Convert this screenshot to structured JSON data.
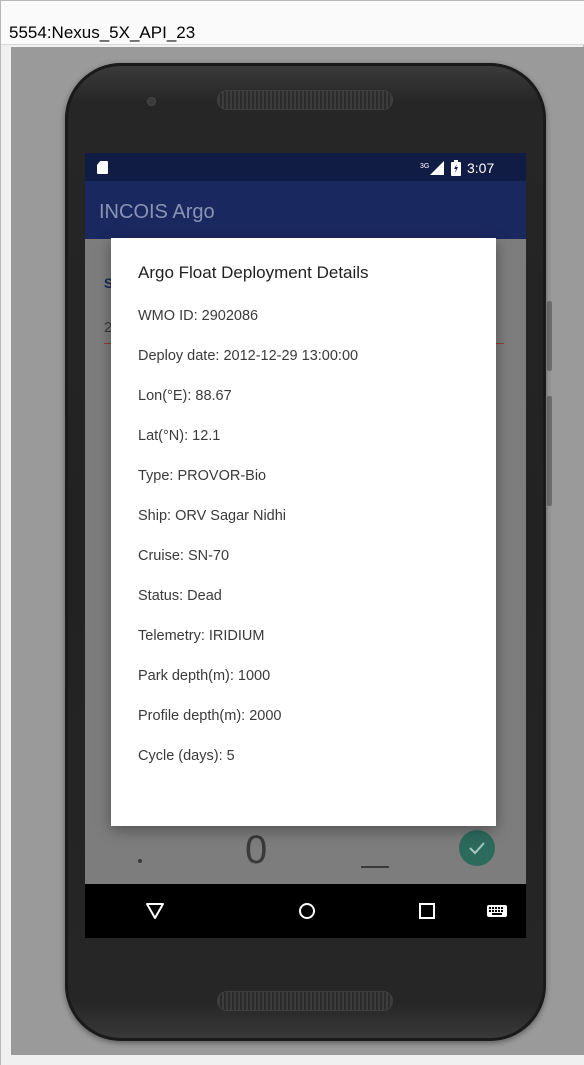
{
  "window": {
    "title": "5554:Nexus_5X_API_23"
  },
  "status_bar": {
    "network_label": "3G",
    "time": "3:07"
  },
  "app_bar": {
    "title": "INCOIS Argo"
  },
  "background": {
    "label_fragment": "S",
    "input_fragment": "2",
    "keypad": {
      "dot_key": ".",
      "zero_key": "0"
    }
  },
  "dialog": {
    "title": "Argo Float Deployment Details",
    "rows": [
      "WMO ID: 2902086",
      "Deploy date: 2012-12-29 13:00:00",
      "Lon(°E): 88.67",
      "Lat(°N): 12.1",
      "Type: PROVOR-Bio",
      "Ship: ORV Sagar Nidhi",
      "Cruise: SN-70",
      "Status: Dead",
      "Telemetry: IRIDIUM",
      "Park depth(m): 1000",
      "Profile depth(m): 2000",
      "Cycle (days): 5"
    ]
  },
  "icons": {
    "status": [
      "sd-card-icon",
      "signal-icon",
      "battery-icon"
    ],
    "nav": [
      "back-icon",
      "home-icon",
      "recents-icon",
      "keyboard-icon"
    ],
    "fab": "check-icon"
  },
  "colors": {
    "status_bar": "#101c44",
    "app_bar": "#1a2860",
    "fab": "#2c6a5c",
    "input_underline": "#9a3a3a"
  }
}
